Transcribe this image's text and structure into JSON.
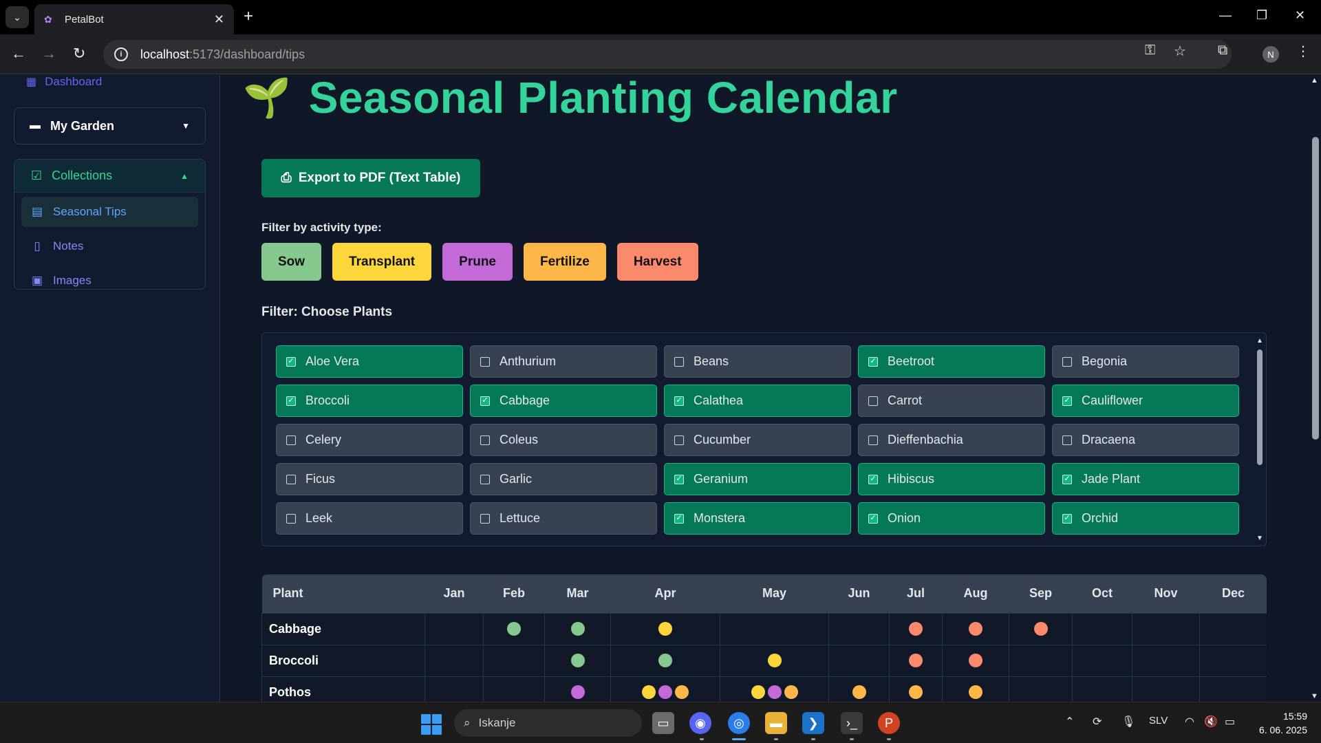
{
  "browser": {
    "tab_title": "PetalBot",
    "url_host": "localhost",
    "url_path": ":5173/dashboard/tips"
  },
  "sidebar": {
    "dashboard_label": "Dashboard",
    "garden_label": "My Garden",
    "collections_label": "Collections",
    "items": [
      {
        "label": "Seasonal Tips",
        "icon": "calendar-icon",
        "active": true
      },
      {
        "label": "Notes",
        "icon": "document-icon",
        "active": false
      },
      {
        "label": "Images",
        "icon": "image-icon",
        "active": false
      }
    ]
  },
  "main": {
    "title": "Seasonal Planting Calendar",
    "export_label": "Export to PDF (Text Table)",
    "activity_filter_label": "Filter by activity type:",
    "plants_filter_label": "Filter: Choose Plants"
  },
  "activities": [
    {
      "label": "Sow",
      "color": "#86c98e"
    },
    {
      "label": "Transplant",
      "color": "#fcd63a"
    },
    {
      "label": "Prune",
      "color": "#c46ad8"
    },
    {
      "label": "Fertilize",
      "color": "#fdb748"
    },
    {
      "label": "Harvest",
      "color": "#fb8a6c"
    }
  ],
  "plants": [
    {
      "name": "Aloe Vera",
      "checked": true
    },
    {
      "name": "Anthurium",
      "checked": false
    },
    {
      "name": "Beans",
      "checked": false
    },
    {
      "name": "Beetroot",
      "checked": true
    },
    {
      "name": "Begonia",
      "checked": false
    },
    {
      "name": "Broccoli",
      "checked": true
    },
    {
      "name": "Cabbage",
      "checked": true
    },
    {
      "name": "Calathea",
      "checked": true
    },
    {
      "name": "Carrot",
      "checked": false
    },
    {
      "name": "Cauliflower",
      "checked": true
    },
    {
      "name": "Celery",
      "checked": false
    },
    {
      "name": "Coleus",
      "checked": false
    },
    {
      "name": "Cucumber",
      "checked": false
    },
    {
      "name": "Dieffenbachia",
      "checked": false
    },
    {
      "name": "Dracaena",
      "checked": false
    },
    {
      "name": "Ficus",
      "checked": false
    },
    {
      "name": "Garlic",
      "checked": false
    },
    {
      "name": "Geranium",
      "checked": true
    },
    {
      "name": "Hibiscus",
      "checked": true
    },
    {
      "name": "Jade Plant",
      "checked": true
    },
    {
      "name": "Leek",
      "checked": false
    },
    {
      "name": "Lettuce",
      "checked": false
    },
    {
      "name": "Monstera",
      "checked": true
    },
    {
      "name": "Onion",
      "checked": true
    },
    {
      "name": "Orchid",
      "checked": true
    }
  ],
  "calendar": {
    "plant_header": "Plant",
    "months": [
      "Jan",
      "Feb",
      "Mar",
      "Apr",
      "May",
      "Jun",
      "Jul",
      "Aug",
      "Sep",
      "Oct",
      "Nov",
      "Dec"
    ],
    "rows": [
      {
        "plant": "Cabbage",
        "cells": [
          [],
          [
            "Sow"
          ],
          [
            "Sow"
          ],
          [
            "Transplant"
          ],
          [],
          [],
          [
            "Harvest"
          ],
          [
            "Harvest"
          ],
          [
            "Harvest"
          ],
          [],
          [],
          []
        ]
      },
      {
        "plant": "Broccoli",
        "cells": [
          [],
          [],
          [
            "Sow"
          ],
          [
            "Sow"
          ],
          [
            "Transplant"
          ],
          [],
          [
            "Harvest"
          ],
          [
            "Harvest"
          ],
          [],
          [],
          [],
          []
        ]
      },
      {
        "plant": "Pothos",
        "cells": [
          [],
          [],
          [
            "Prune"
          ],
          [
            "Transplant",
            "Prune",
            "Fertilize"
          ],
          [
            "Transplant",
            "Prune",
            "Fertilize"
          ],
          [
            "Fertilize"
          ],
          [
            "Fertilize"
          ],
          [
            "Fertilize"
          ],
          [],
          [],
          [],
          []
        ]
      }
    ]
  },
  "taskbar": {
    "search_placeholder": "Iskanje",
    "language": "SLV",
    "time": "15:59",
    "date": "6. 06. 2025"
  }
}
